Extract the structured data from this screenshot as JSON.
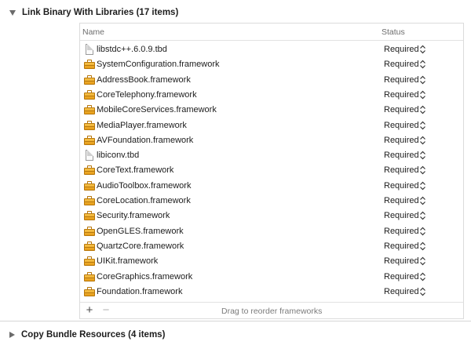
{
  "sections": {
    "link_binary": {
      "title": "Link Binary With Libraries (17 items)",
      "expanded": true
    },
    "copy_bundle": {
      "title": "Copy Bundle Resources (4 items)",
      "expanded": false
    }
  },
  "table": {
    "columns": {
      "name": "Name",
      "status": "Status"
    },
    "rows": [
      {
        "name": "libstdc++.6.0.9.tbd",
        "status": "Required",
        "kind": "tbd"
      },
      {
        "name": "SystemConfiguration.framework",
        "status": "Required",
        "kind": "framework"
      },
      {
        "name": "AddressBook.framework",
        "status": "Required",
        "kind": "framework"
      },
      {
        "name": "CoreTelephony.framework",
        "status": "Required",
        "kind": "framework"
      },
      {
        "name": "MobileCoreServices.framework",
        "status": "Required",
        "kind": "framework"
      },
      {
        "name": "MediaPlayer.framework",
        "status": "Required",
        "kind": "framework"
      },
      {
        "name": "AVFoundation.framework",
        "status": "Required",
        "kind": "framework"
      },
      {
        "name": "libiconv.tbd",
        "status": "Required",
        "kind": "tbd"
      },
      {
        "name": "CoreText.framework",
        "status": "Required",
        "kind": "framework"
      },
      {
        "name": "AudioToolbox.framework",
        "status": "Required",
        "kind": "framework"
      },
      {
        "name": "CoreLocation.framework",
        "status": "Required",
        "kind": "framework"
      },
      {
        "name": "Security.framework",
        "status": "Required",
        "kind": "framework"
      },
      {
        "name": "OpenGLES.framework",
        "status": "Required",
        "kind": "framework"
      },
      {
        "name": "QuartzCore.framework",
        "status": "Required",
        "kind": "framework"
      },
      {
        "name": "UIKit.framework",
        "status": "Required",
        "kind": "framework"
      },
      {
        "name": "CoreGraphics.framework",
        "status": "Required",
        "kind": "framework"
      },
      {
        "name": "Foundation.framework",
        "status": "Required",
        "kind": "framework"
      }
    ],
    "footer": {
      "add_label": "+",
      "remove_label": "−",
      "hint": "Drag to reorder frameworks"
    }
  },
  "icons": {
    "framework": "framework-icon",
    "tbd": "tbd-file-icon",
    "status_stepper": "up-down-stepper-icon",
    "disclosure_open": "disclosure-triangle-down-icon",
    "disclosure_closed": "disclosure-triangle-right-icon"
  }
}
